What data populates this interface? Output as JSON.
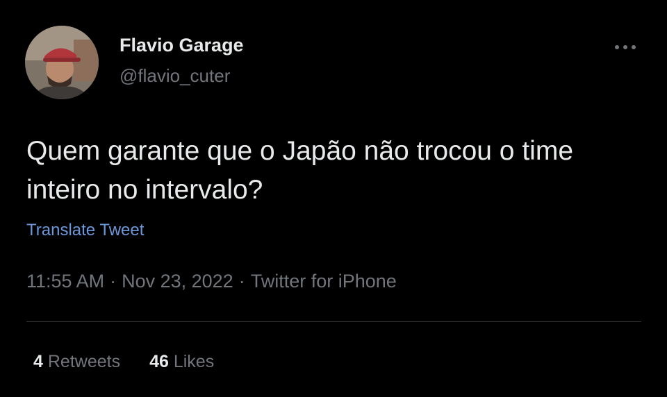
{
  "author": {
    "name": "Flavio Garage",
    "handle": "@flavio_cuter",
    "avatar_icon": "profile-photo"
  },
  "tweet": {
    "text": "Quem garante que o Japão não trocou o time inteiro no intervalo?",
    "translate_label": "Translate Tweet"
  },
  "meta": {
    "time": "11:55 AM",
    "separator": "·",
    "date": "Nov 23, 2022",
    "source": "Twitter for iPhone"
  },
  "stats": {
    "retweets_count": "4",
    "retweets_label": "Retweets",
    "likes_count": "46",
    "likes_label": "Likes"
  },
  "menu_icon": "more-horizontal-icon",
  "colors": {
    "background": "#000000",
    "primary_text": "#e7e9ea",
    "secondary_text": "#71767b",
    "link": "#6c98d9",
    "divider": "#2f3336"
  }
}
